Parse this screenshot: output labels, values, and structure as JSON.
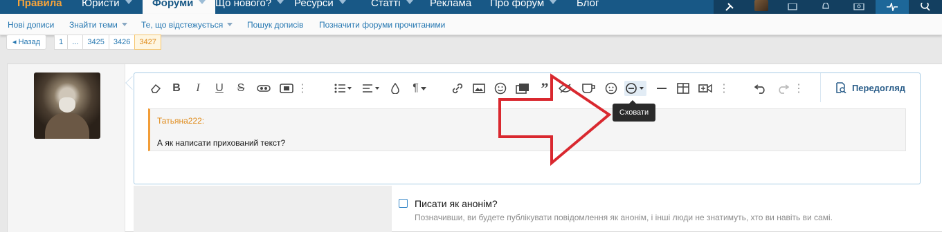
{
  "nav": {
    "items": [
      {
        "label": "Правила",
        "caret": false
      },
      {
        "label": "Юристи",
        "caret": true
      },
      {
        "label": "Форуми",
        "caret": true,
        "active": true
      },
      {
        "label": "Що нового?",
        "caret": true
      },
      {
        "label": "Ресурси",
        "caret": true
      },
      {
        "label": "Статті",
        "caret": true
      },
      {
        "label": "Реклама",
        "caret": false
      },
      {
        "label": "Про форум",
        "caret": true
      },
      {
        "label": "Блог",
        "caret": false
      }
    ],
    "right_icons": [
      "tools-icon",
      "avatar",
      "mail-icon",
      "bell-icon",
      "image-icon",
      "activity-icon",
      "search-icon"
    ]
  },
  "subnav": {
    "items": [
      {
        "label": "Нові дописи",
        "caret": false
      },
      {
        "label": "Знайти теми",
        "caret": true
      },
      {
        "label": "Те, що відстежується",
        "caret": true
      },
      {
        "label": "Пошук дописів",
        "caret": false
      },
      {
        "label": "Позначити форуми прочитаними",
        "caret": false
      }
    ]
  },
  "pagination": {
    "prev_label": "◂ Назад",
    "pages": [
      "1",
      "...",
      "3425",
      "3426",
      "3427"
    ],
    "current": "3427"
  },
  "editor": {
    "preview_label": "Передогляд",
    "tooltip": "Сховати",
    "toolbar_icons": [
      "eraser-icon",
      "bold-icon",
      "italic-icon",
      "underline-icon",
      "strikethrough-icon",
      "spoiler-icon",
      "inline-spoiler-icon",
      "more-icon",
      "list-icon",
      "align-icon",
      "color-icon",
      "paragraph-icon",
      "link-icon",
      "image-icon",
      "smilie-icon",
      "media-icon",
      "quote-icon",
      "hide-icon",
      "code-icon",
      "emoji-icon",
      "hide-content-icon",
      "hr-icon",
      "table-icon",
      "video-icon",
      "more-icon",
      "undo-icon",
      "redo-icon",
      "more-icon"
    ],
    "quote": {
      "author": "Татьяна222:",
      "text": "А як написати прихований текст?"
    }
  },
  "anonymous": {
    "label": "Писати як анонім?",
    "hint": "Позначивши, ви будете публікувати повідомлення як анонім, і інші люди не знатимуть, хто ви навіть ви самі."
  },
  "colors": {
    "nav_bg": "#185886",
    "brand": "#f7a43a",
    "link": "#2577b1",
    "annotation_arrow": "#d9282f"
  }
}
